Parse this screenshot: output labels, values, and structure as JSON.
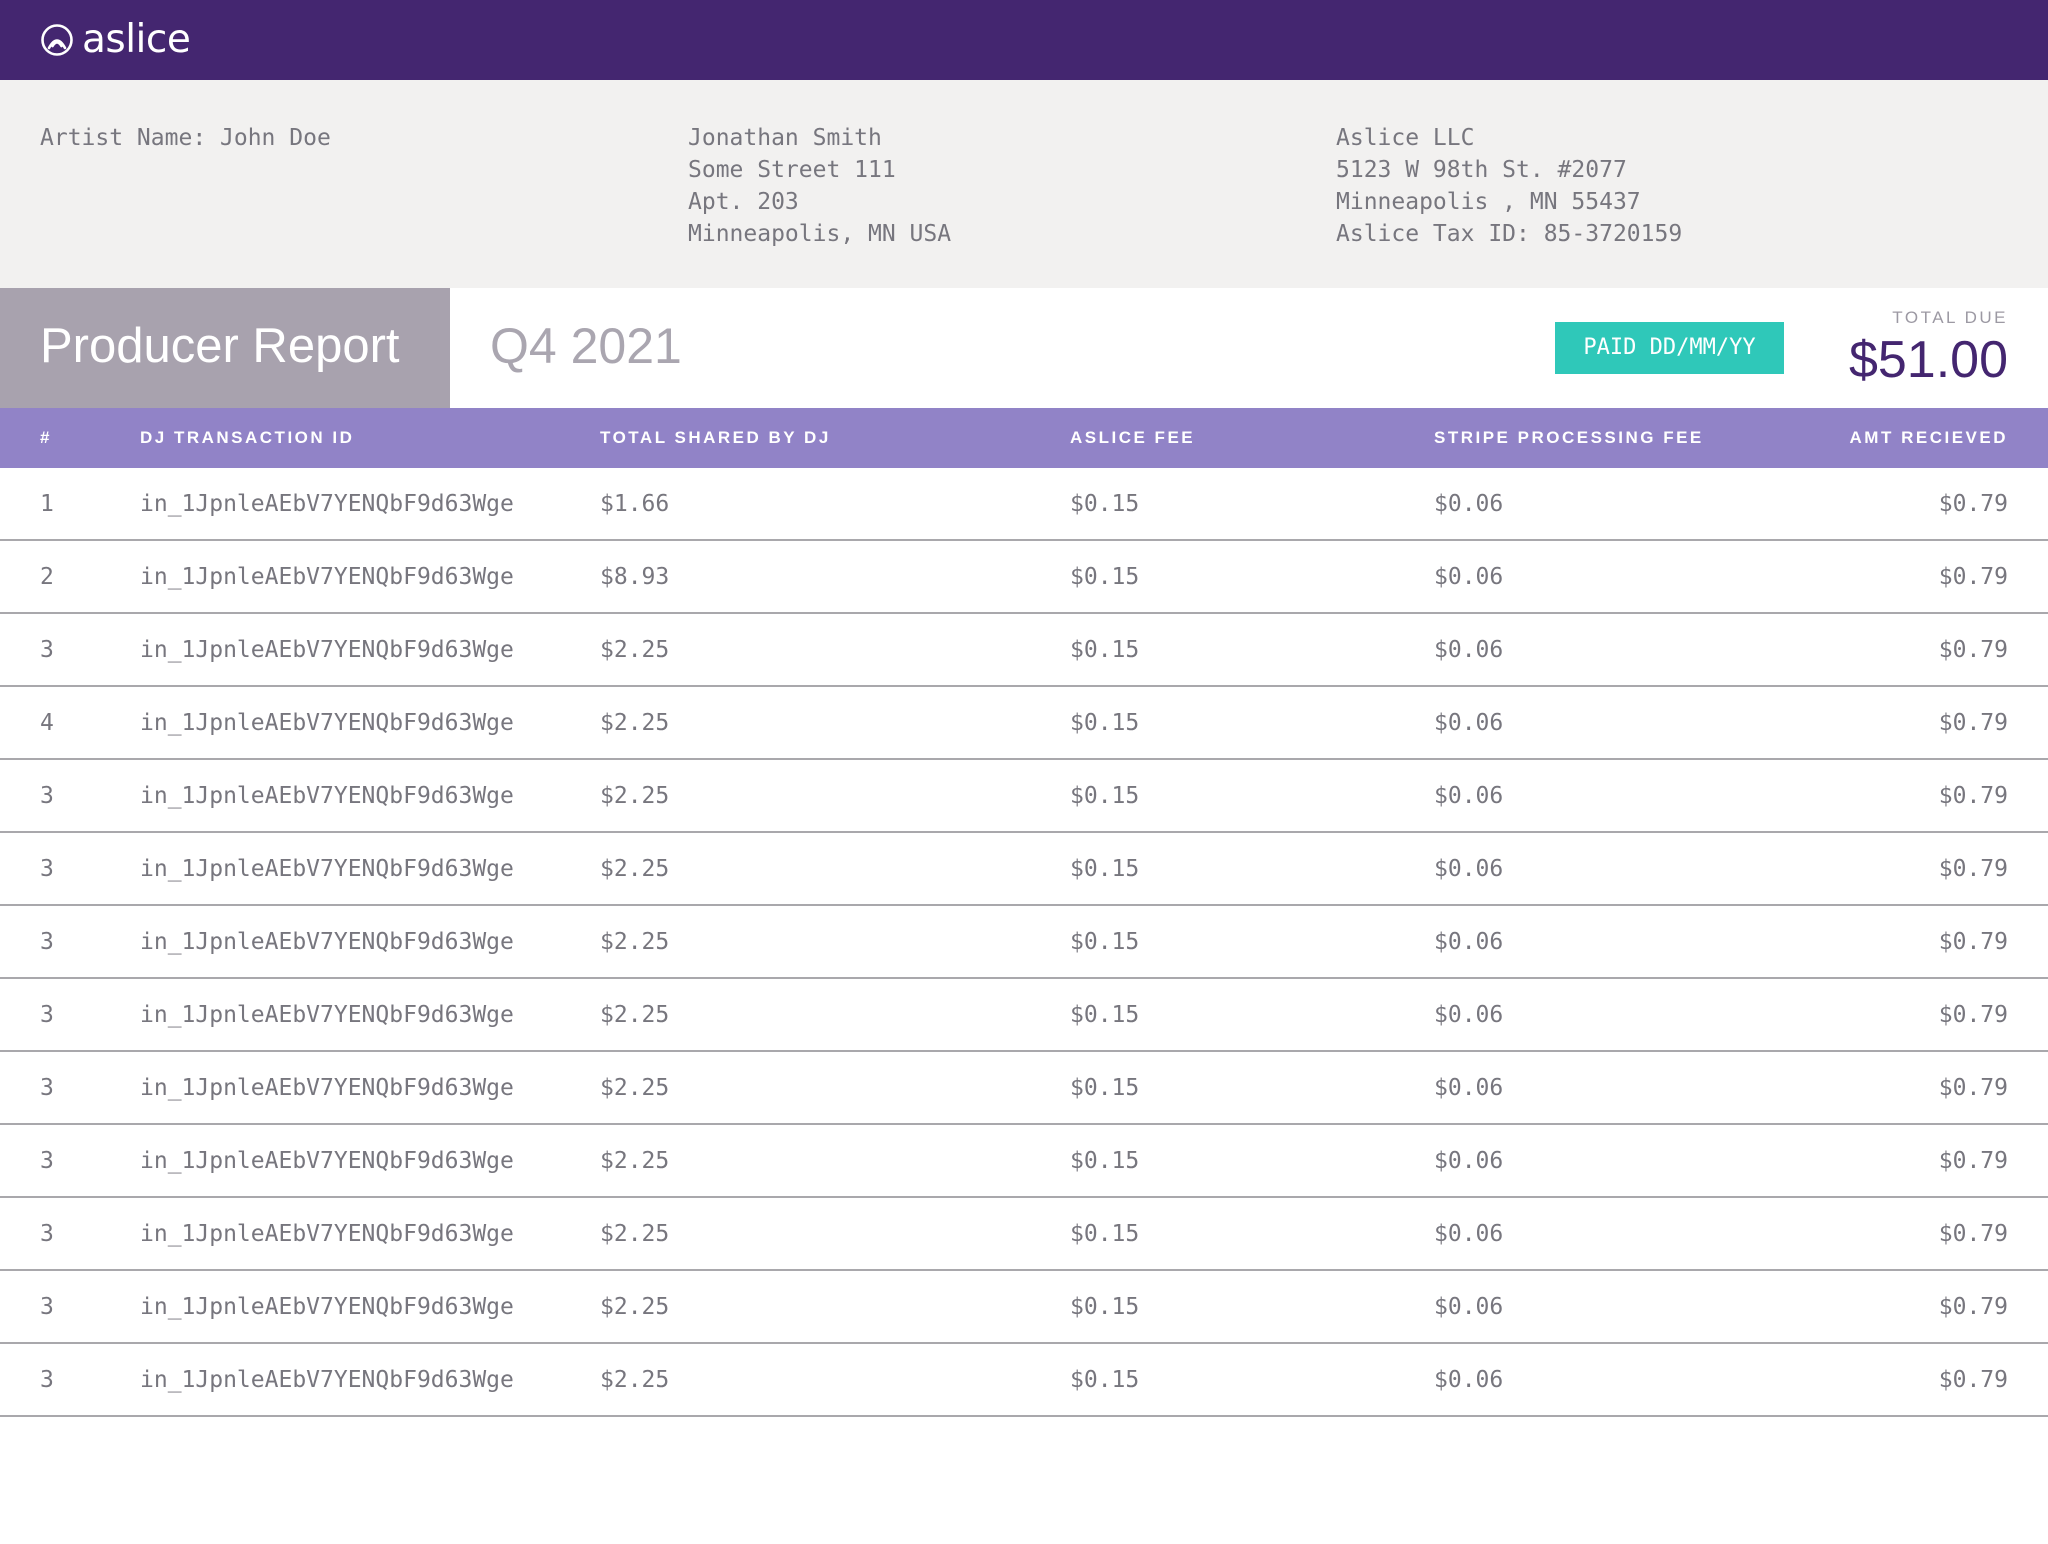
{
  "brand": {
    "name": "aslice",
    "logo_icon": "aslice-logo-icon"
  },
  "artist": {
    "line": "Artist Name: John Doe"
  },
  "payee": {
    "lines": [
      "Jonathan Smith",
      "Some Street 111",
      "Apt. 203",
      "Minneapolis, MN USA"
    ]
  },
  "company": {
    "lines": [
      "Aslice LLC",
      "5123 W 98th St. #2077",
      "Minneapolis , MN 55437",
      "Aslice Tax ID: 85-3720159"
    ]
  },
  "report": {
    "title": "Producer Report",
    "period": "Q4 2021",
    "paid_badge": "PAID DD/MM/YY",
    "total_due_label": "TOTAL DUE",
    "total_due_amount": "$51.00"
  },
  "colors": {
    "brand_purple": "#442670",
    "table_header": "#9183c7",
    "paid_teal": "#2fc8b9",
    "info_bg": "#f2f1f0",
    "title_box": "#a8a2ae"
  },
  "table": {
    "headers": [
      "#",
      "DJ TRANSACTION ID",
      "TOTAL SHARED BY DJ",
      "ASLICE FEE",
      "STRIPE PROCESSING FEE",
      "AMT RECIEVED"
    ],
    "rows": [
      [
        "1",
        "in_1JpnleAEbV7YENQbF9d63Wge",
        "$1.66",
        "$0.15",
        "$0.06",
        "$0.79"
      ],
      [
        "2",
        "in_1JpnleAEbV7YENQbF9d63Wge",
        "$8.93",
        "$0.15",
        "$0.06",
        "$0.79"
      ],
      [
        "3",
        "in_1JpnleAEbV7YENQbF9d63Wge",
        "$2.25",
        "$0.15",
        "$0.06",
        "$0.79"
      ],
      [
        "4",
        "in_1JpnleAEbV7YENQbF9d63Wge",
        "$2.25",
        "$0.15",
        "$0.06",
        "$0.79"
      ],
      [
        "3",
        "in_1JpnleAEbV7YENQbF9d63Wge",
        "$2.25",
        "$0.15",
        "$0.06",
        "$0.79"
      ],
      [
        "3",
        "in_1JpnleAEbV7YENQbF9d63Wge",
        "$2.25",
        "$0.15",
        "$0.06",
        "$0.79"
      ],
      [
        "3",
        "in_1JpnleAEbV7YENQbF9d63Wge",
        "$2.25",
        "$0.15",
        "$0.06",
        "$0.79"
      ],
      [
        "3",
        "in_1JpnleAEbV7YENQbF9d63Wge",
        "$2.25",
        "$0.15",
        "$0.06",
        "$0.79"
      ],
      [
        "3",
        "in_1JpnleAEbV7YENQbF9d63Wge",
        "$2.25",
        "$0.15",
        "$0.06",
        "$0.79"
      ],
      [
        "3",
        "in_1JpnleAEbV7YENQbF9d63Wge",
        "$2.25",
        "$0.15",
        "$0.06",
        "$0.79"
      ],
      [
        "3",
        "in_1JpnleAEbV7YENQbF9d63Wge",
        "$2.25",
        "$0.15",
        "$0.06",
        "$0.79"
      ],
      [
        "3",
        "in_1JpnleAEbV7YENQbF9d63Wge",
        "$2.25",
        "$0.15",
        "$0.06",
        "$0.79"
      ],
      [
        "3",
        "in_1JpnleAEbV7YENQbF9d63Wge",
        "$2.25",
        "$0.15",
        "$0.06",
        "$0.79"
      ]
    ]
  }
}
